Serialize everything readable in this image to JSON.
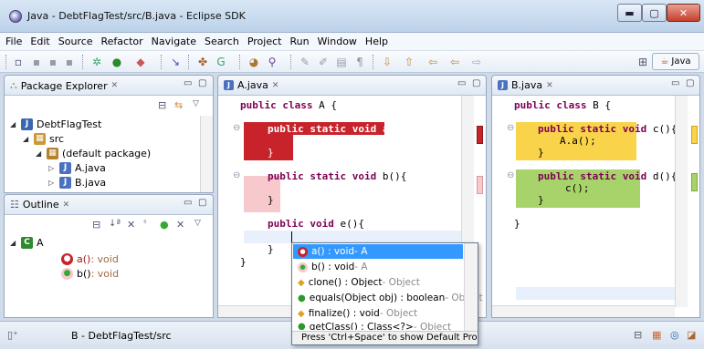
{
  "window": {
    "title": "Java - DebtFlagTest/src/B.java - Eclipse SDK",
    "min": "▬",
    "max": "▢",
    "close": "✕"
  },
  "menu": [
    "File",
    "Edit",
    "Source",
    "Refactor",
    "Navigate",
    "Search",
    "Project",
    "Run",
    "Window",
    "Help"
  ],
  "toolbar": {
    "perspective": "Java"
  },
  "package_explorer": {
    "title": "Package Explorer",
    "close": "✕",
    "items": [
      "DebtFlagTest",
      "src",
      "(default package)",
      "A.java",
      "B.java"
    ]
  },
  "outline": {
    "title": "Outline",
    "close": "✕",
    "class_name": "A",
    "methods": [
      {
        "name": "a()",
        "type": " : void"
      },
      {
        "name": "b()",
        "type": " : void"
      }
    ]
  },
  "editor_a": {
    "tab": "A.java",
    "close": "✕",
    "lines": {
      "class_kw": "public class",
      "class_rest": " A {",
      "a_kw": "public static void",
      "a_rest": " a(){",
      "a_close": "}",
      "b_kw": "public static void",
      "b_rest": " b(){",
      "b_close": "}",
      "e_kw": "public void",
      "e_rest": " e(){",
      "e_close": "}",
      "class_close": "}"
    },
    "colors": {
      "red_flag": "#c8232b",
      "pink_flag": "#f8c9cc"
    }
  },
  "editor_b": {
    "tab": "B.java",
    "close": "✕",
    "lines": {
      "class_kw": "public class",
      "class_rest": " B {",
      "c_kw": "public static void",
      "c_rest": " c(){",
      "c_body": "A.a();",
      "c_close": "}",
      "d_kw": "public static void",
      "d_rest": " d(){",
      "d_body": "c();",
      "d_close": "}",
      "class_close": "}"
    },
    "colors": {
      "yellow_flag": "#f9d44a",
      "green_flag": "#a7d36a"
    }
  },
  "content_assist": {
    "proposals": [
      {
        "sig": "a() : void",
        "owner": " - A"
      },
      {
        "sig": "b() : void",
        "owner": " - A"
      },
      {
        "sig": "clone() : Object",
        "owner": " - Object"
      },
      {
        "sig": "equals(Object obj) : boolean",
        "owner": " - Object"
      },
      {
        "sig": "finalize() : void",
        "owner": " - Object"
      },
      {
        "sig": "getClass() : Class<?>",
        "owner": " - Object"
      }
    ],
    "footer": "Press 'Ctrl+Space' to show Default Proposals"
  },
  "status": {
    "text": "B - DebtFlagTest/src"
  }
}
